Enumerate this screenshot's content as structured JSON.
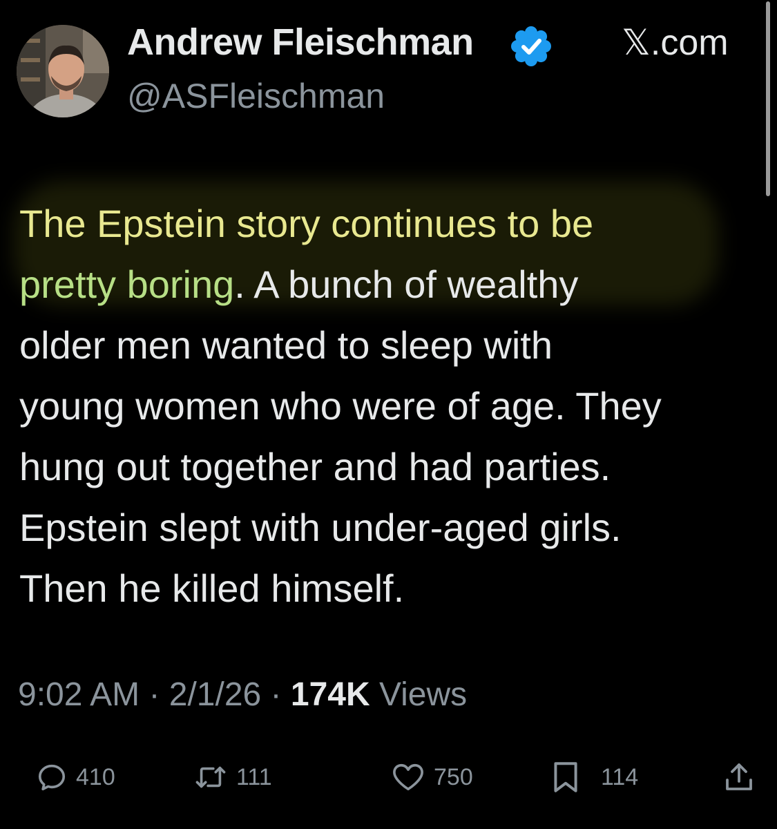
{
  "author": {
    "display_name": "Andrew Fleischman",
    "handle": "@ASFleischman",
    "verified": true
  },
  "site_label": "𝕏.com",
  "tweet": {
    "lines": [
      "The Epstein story continues to be",
      "pretty boring",
      ". A bunch of wealthy",
      "older men wanted to sleep with",
      "young women who were of age. They",
      "hung out together and had parties.",
      "Epstein slept with under-aged girls.",
      "Then he killed himself."
    ]
  },
  "meta": {
    "time": "9:02 AM",
    "separator": " · ",
    "date": "2/1/26",
    "views_count": "174K",
    "views_label": " Views"
  },
  "actions": {
    "replies": "410",
    "reposts": "111",
    "likes": "750",
    "bookmarks": "114"
  },
  "colors": {
    "background": "#000000",
    "text": "#e7e9ea",
    "secondary": "#8b949c",
    "verified_badge": "#1d9bf0",
    "highlight_yellow": "#e8e890",
    "highlight_green": "#b7df86"
  },
  "icons": [
    "verified-badge-icon",
    "reply-icon",
    "repost-icon",
    "like-icon",
    "bookmark-icon",
    "share-icon"
  ]
}
